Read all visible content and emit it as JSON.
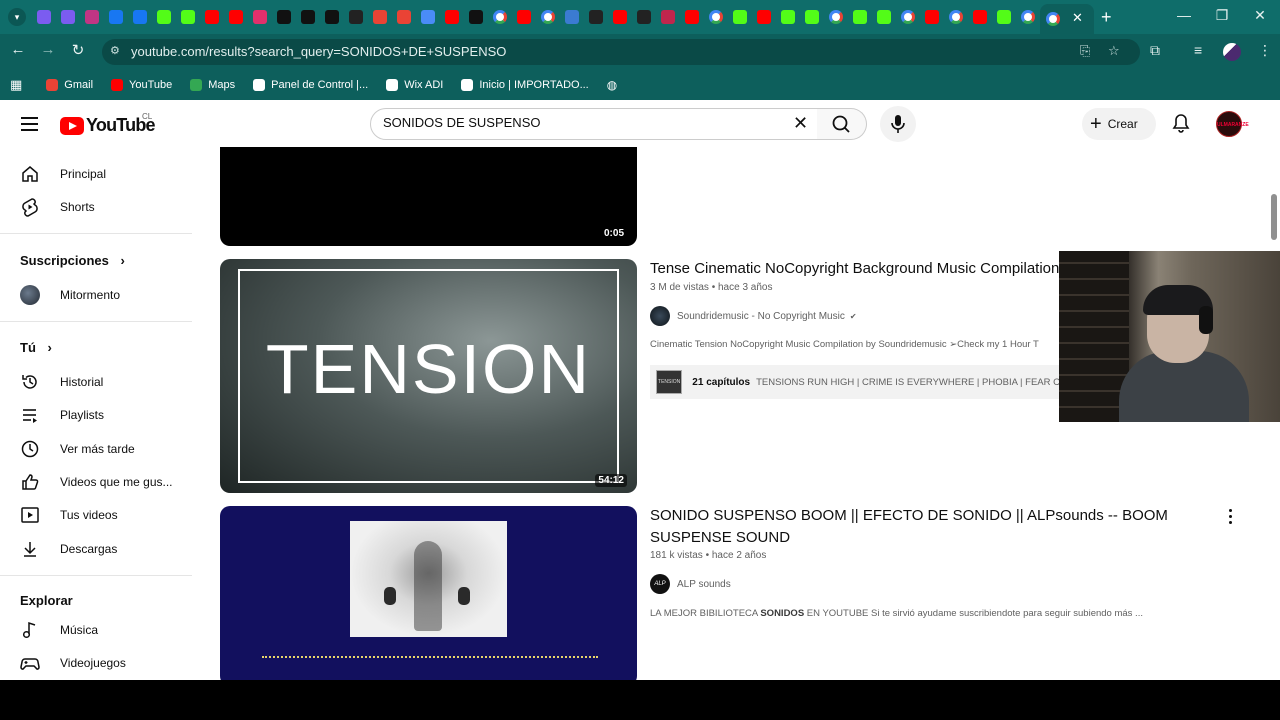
{
  "browser": {
    "tab_count_label": "",
    "new_tab_label": "+",
    "active_tab_close": "✕",
    "window_controls": {
      "minimize": "—",
      "restore": "❐",
      "close": "✕"
    },
    "nav": {
      "back": "←",
      "forward": "→",
      "reload": "↻"
    },
    "url": "youtube.com/results?search_query=SONIDOS+DE+SUSPENSO",
    "tab_favicons": [
      {
        "icon": "film-icon",
        "color": "#7b5cf0"
      },
      {
        "icon": "film-icon",
        "color": "#7b5cf0"
      },
      {
        "icon": "instagram-icon",
        "color": "#c13584"
      },
      {
        "icon": "facebook-icon",
        "color": "#1877f2"
      },
      {
        "icon": "facebook-icon",
        "color": "#1877f2"
      },
      {
        "icon": "kick-icon",
        "color": "#53fc18"
      },
      {
        "icon": "kick-icon",
        "color": "#53fc18"
      },
      {
        "icon": "youtube-icon",
        "color": "#ff0000"
      },
      {
        "icon": "youtube-icon",
        "color": "#ff0000"
      },
      {
        "icon": "instagram-icon",
        "color": "#e1306c"
      },
      {
        "icon": "tiktok-icon",
        "color": "#111111"
      },
      {
        "icon": "tiktok-icon",
        "color": "#111111"
      },
      {
        "icon": "tiktok-icon",
        "color": "#111111"
      },
      {
        "icon": "generic-icon",
        "color": "#222222"
      },
      {
        "icon": "gmail-icon",
        "color": "#ea4335"
      },
      {
        "icon": "gmail-icon",
        "color": "#ea4335"
      },
      {
        "icon": "gemini-icon",
        "color": "#4a8cf7"
      },
      {
        "icon": "youtube-icon",
        "color": "#ff0000"
      },
      {
        "icon": "threads-icon",
        "color": "#111111"
      },
      {
        "icon": "google-icon",
        "color": "#ffffff"
      },
      {
        "icon": "youtube-icon",
        "color": "#ff0000"
      },
      {
        "icon": "google-icon",
        "color": "#ffffff"
      },
      {
        "icon": "generic-icon",
        "color": "#3b7bd1"
      },
      {
        "icon": "anchor-icon",
        "color": "#222222"
      },
      {
        "icon": "youtube-icon",
        "color": "#ff0000"
      },
      {
        "icon": "anchor-icon",
        "color": "#222222"
      },
      {
        "icon": "generic-icon",
        "color": "#c0264d"
      },
      {
        "icon": "youtube-icon",
        "color": "#ff0000"
      },
      {
        "icon": "google-icon",
        "color": "#ffffff"
      },
      {
        "icon": "kick-icon",
        "color": "#53fc18"
      },
      {
        "icon": "youtube-icon",
        "color": "#ff0000"
      },
      {
        "icon": "kick-icon",
        "color": "#53fc18"
      },
      {
        "icon": "kick-icon",
        "color": "#53fc18"
      },
      {
        "icon": "google-icon",
        "color": "#ffffff"
      },
      {
        "icon": "kick-icon",
        "color": "#53fc18"
      },
      {
        "icon": "kick-icon",
        "color": "#53fc18"
      },
      {
        "icon": "google-icon",
        "color": "#ffffff"
      },
      {
        "icon": "youtube-icon",
        "color": "#ff0000"
      },
      {
        "icon": "google-icon",
        "color": "#ffffff"
      },
      {
        "icon": "youtube-icon",
        "color": "#ff0000"
      },
      {
        "icon": "kick-icon",
        "color": "#53fc18"
      },
      {
        "icon": "google-icon",
        "color": "#ffffff"
      }
    ],
    "bookmarks": [
      {
        "label": "Gmail",
        "icon": "gmail-icon",
        "color": "#ea4335"
      },
      {
        "label": "YouTube",
        "icon": "youtube-icon",
        "color": "#ff0000"
      },
      {
        "label": "Maps",
        "icon": "maps-icon",
        "color": "#34a853"
      },
      {
        "label": "Panel de Control |...",
        "icon": "wix-icon",
        "color": "#ffffff"
      },
      {
        "label": "Wix ADI",
        "icon": "wix-icon",
        "color": "#ffffff"
      },
      {
        "label": "Inicio | IMPORTADO...",
        "icon": "wix-icon",
        "color": "#ffffff"
      }
    ]
  },
  "youtube": {
    "logo_text": "YouTube",
    "country_code": "CL",
    "search_value": "SONIDOS DE SUSPENSO",
    "search_clear": "✕",
    "create_label": "Crear",
    "avatar_text": "ULMARANZE"
  },
  "sidebar": {
    "main": [
      {
        "label": "Principal",
        "icon": "home-icon"
      },
      {
        "label": "Shorts",
        "icon": "shorts-icon"
      }
    ],
    "subscriptions_title": "Suscripciones",
    "subscriptions": [
      {
        "label": "Mitormento",
        "icon": "channel-avatar"
      }
    ],
    "you_title": "Tú",
    "you": [
      {
        "label": "Historial",
        "icon": "history-icon"
      },
      {
        "label": "Playlists",
        "icon": "playlist-icon"
      },
      {
        "label": "Ver más tarde",
        "icon": "clock-icon"
      },
      {
        "label": "Videos que me gus...",
        "icon": "thumbs-up-icon"
      },
      {
        "label": "Tus videos",
        "icon": "video-icon"
      },
      {
        "label": "Descargas",
        "icon": "download-icon"
      }
    ],
    "explore_title": "Explorar",
    "explore": [
      {
        "label": "Música",
        "icon": "music-icon"
      },
      {
        "label": "Videojuegos",
        "icon": "gamepad-icon"
      }
    ]
  },
  "results": [
    {
      "duration": "0:05"
    },
    {
      "title": "Tense Cinematic NoCopyright Background Music Compilation",
      "views": "3 M de vistas",
      "age": "hace 3 años",
      "channel": "Soundridemusic - No Copyright Music",
      "verified": "✔",
      "description": "Cinematic Tension NoCopyright Music Compilation by Soundridemusic ➢Check my 1 Hour T",
      "duration": "54:12",
      "thumb_text": "TENSION",
      "chapters_count": "21 capítulos",
      "chapters_list": "TENSIONS RUN HIGH | CRIME IS EVERYWHERE | PHOBIA | FEAR C",
      "chapter_thumb_text": "TENSION"
    },
    {
      "title": "SONIDO SUSPENSO BOOM || EFECTO DE SONIDO || ALPsounds -- BOOM SUSPENSE SOUND",
      "views": "181 k vistas",
      "age": "hace 2 años",
      "channel": "ALP sounds",
      "channel_avatar_text": "ALP",
      "description_pre": "LA MEJOR BIBILIOTECA ",
      "description_bold": "SONIDOS",
      "description_post": " EN YOUTUBE Si te sirvió ayudame suscribiendote para seguir subiendo más ..."
    }
  ],
  "colors": {
    "chrome_bg": "#0f6d6a",
    "youtube_red": "#ff0000",
    "thumb3_bg": "#12105e"
  }
}
